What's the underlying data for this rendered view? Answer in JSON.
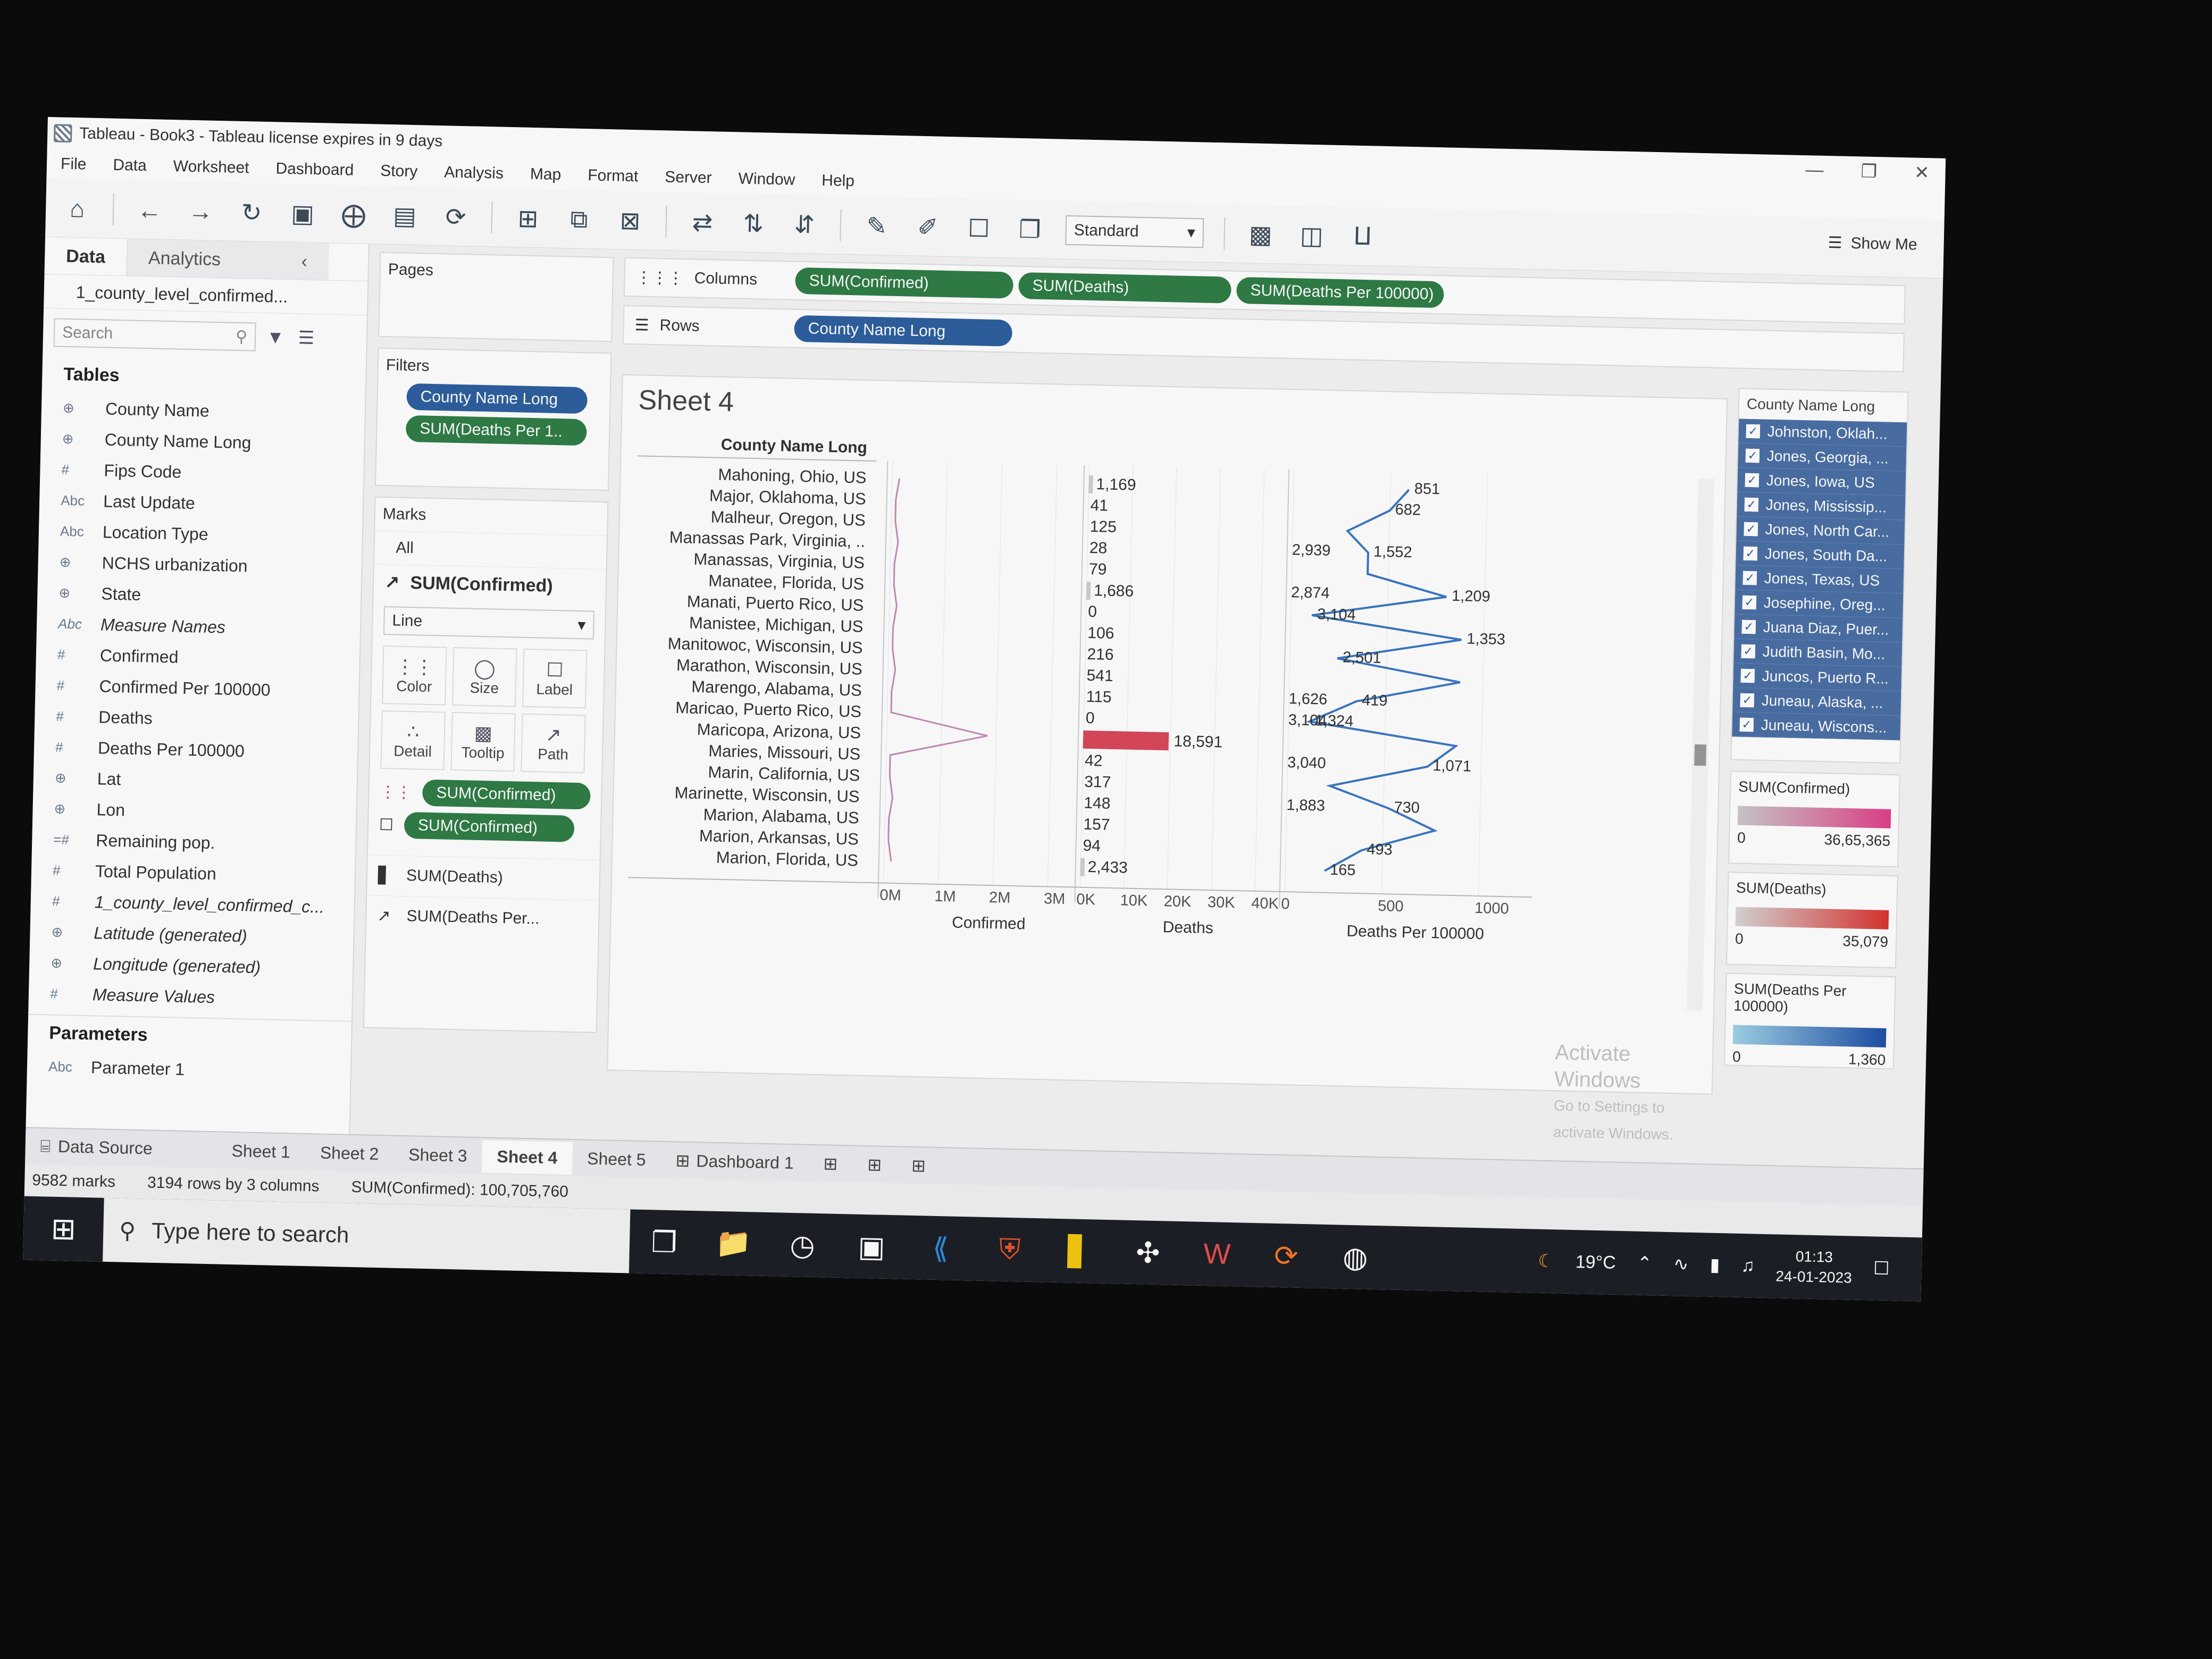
{
  "window": {
    "title": "Tableau - Book3 - Tableau license expires in 9 days"
  },
  "menu": [
    "File",
    "Data",
    "Worksheet",
    "Dashboard",
    "Story",
    "Analysis",
    "Map",
    "Format",
    "Server",
    "Window",
    "Help"
  ],
  "toolbar": {
    "fit_select": "Standard",
    "show_me": "Show Me"
  },
  "datapane": {
    "tab_data": "Data",
    "tab_analytics": "Analytics",
    "datasource": "1_county_level_confirmed...",
    "search_placeholder": "Search",
    "tables_header": "Tables",
    "fields": [
      {
        "icon": "globe",
        "name": "County Name"
      },
      {
        "icon": "globe",
        "name": "County Name Long"
      },
      {
        "icon": "#",
        "name": "Fips Code"
      },
      {
        "icon": "Abc",
        "name": "Last Update"
      },
      {
        "icon": "Abc",
        "name": "Location Type"
      },
      {
        "icon": "globe",
        "name": "NCHS urbanization"
      },
      {
        "icon": "globe",
        "name": "State"
      },
      {
        "icon": "Abc",
        "name": "Measure Names",
        "italic": true
      },
      {
        "icon": "#",
        "name": "Confirmed"
      },
      {
        "icon": "#",
        "name": "Confirmed Per 100000"
      },
      {
        "icon": "#",
        "name": "Deaths"
      },
      {
        "icon": "#",
        "name": "Deaths Per 100000"
      },
      {
        "icon": "globe",
        "name": "Lat"
      },
      {
        "icon": "globe",
        "name": "Lon"
      },
      {
        "icon": "=#",
        "name": "Remaining pop."
      },
      {
        "icon": "#",
        "name": "Total Population"
      },
      {
        "icon": "#",
        "name": "1_county_level_confirmed_c...",
        "italic": true
      },
      {
        "icon": "globe",
        "name": "Latitude (generated)",
        "italic": true
      },
      {
        "icon": "globe",
        "name": "Longitude (generated)",
        "italic": true
      },
      {
        "icon": "#",
        "name": "Measure Values",
        "italic": true
      }
    ],
    "parameters_header": "Parameters",
    "parameters": [
      {
        "icon": "Abc",
        "name": "Parameter 1"
      }
    ]
  },
  "pages": {
    "label": "Pages"
  },
  "filters": {
    "label": "Filters",
    "items": [
      "County Name Long",
      "SUM(Deaths Per 1.."
    ]
  },
  "marks": {
    "label": "Marks",
    "all": "All",
    "active": "SUM(Confirmed)",
    "type": "Line",
    "buttons": [
      "Color",
      "Size",
      "Label",
      "Detail",
      "Tooltip",
      "Path"
    ],
    "pills": [
      "SUM(Confirmed)",
      "SUM(Confirmed)"
    ],
    "other_cards": [
      "SUM(Deaths)",
      "SUM(Deaths Per..."
    ]
  },
  "shelves": {
    "columns_label": "Columns",
    "rows_label": "Rows",
    "columns": [
      "SUM(Confirmed)",
      "SUM(Deaths)",
      "SUM(Deaths Per 100000)"
    ],
    "rows": [
      "County Name Long"
    ]
  },
  "sheet": {
    "title": "Sheet 4",
    "row_header": "County Name Long"
  },
  "chart_data": {
    "type": "table",
    "rows": [
      "Mahoning, Ohio, US",
      "Major, Oklahoma, US",
      "Malheur, Oregon, US",
      "Manassas Park, Virginia, ..",
      "Manassas, Virginia, US",
      "Manatee, Florida, US",
      "Manati, Puerto Rico, US",
      "Manistee, Michigan, US",
      "Manitowoc, Wisconsin, US",
      "Marathon, Wisconsin, US",
      "Marengo, Alabama, US",
      "Maricao, Puerto Rico, US",
      "Maricopa, Arizona, US",
      "Maries, Missouri, US",
      "Marin, California, US",
      "Marinette, Wisconsin, US",
      "Marion, Alabama, US",
      "Marion, Arkansas, US",
      "Marion, Florida, US"
    ],
    "panes": [
      {
        "measure": "Confirmed",
        "type": "line",
        "axis_title": "Confirmed",
        "ticks": [
          "0M",
          "1M",
          "2M",
          "3M"
        ],
        "xlim": [
          0,
          3500000
        ],
        "peak_row": "Maricopa, Arizona, US"
      },
      {
        "measure": "Deaths",
        "type": "bar",
        "axis_title": "Deaths",
        "ticks": [
          "0K",
          "10K",
          "20K",
          "30K",
          "40K"
        ],
        "xlim": [
          0,
          45000
        ],
        "values": [
          1169,
          41,
          125,
          28,
          79,
          1686,
          0,
          106,
          216,
          541,
          115,
          0,
          18591,
          42,
          317,
          148,
          157,
          94,
          2433
        ],
        "labels": [
          "1,169",
          "41",
          "125",
          "28",
          "79",
          "1,686",
          "0",
          "106",
          "216",
          "541",
          "115",
          "0",
          "18,591",
          "42",
          "317",
          "148",
          "157",
          "94",
          "2,433"
        ]
      },
      {
        "measure": "Deaths Per 100000",
        "type": "line",
        "axis_title": "Deaths Per 100000",
        "ticks": [
          "0",
          "500",
          "1000"
        ],
        "xlim": [
          0,
          1200
        ],
        "values": [
          851,
          682,
          305,
          495,
          495,
          1209,
          0,
          1353,
          238,
          1350,
          419,
          0,
          1324,
          1071,
          195,
          730,
          1150,
          493,
          165
        ],
        "labels": [
          {
            "row": 0,
            "text": "851"
          },
          {
            "row": 1,
            "text": "682"
          },
          {
            "row": 3,
            "text": "2,939"
          },
          {
            "row": 3,
            "text": "1,552"
          },
          {
            "row": 5,
            "text": "2,874"
          },
          {
            "row": 5,
            "text": "1,209"
          },
          {
            "row": 6,
            "text": "3,104"
          },
          {
            "row": 7,
            "text": "1,353"
          },
          {
            "row": 8,
            "text": "2,501"
          },
          {
            "row": 10,
            "text": "1,626"
          },
          {
            "row": 10,
            "text": "419"
          },
          {
            "row": 11,
            "text": "3,104"
          },
          {
            "row": 11,
            "text": "1,324"
          },
          {
            "row": 13,
            "text": "3,040"
          },
          {
            "row": 13,
            "text": "1,071"
          },
          {
            "row": 15,
            "text": "1,883"
          },
          {
            "row": 15,
            "text": "730"
          },
          {
            "row": 17,
            "text": "493"
          },
          {
            "row": 18,
            "text": "165"
          }
        ]
      }
    ]
  },
  "legend_list": {
    "title": "County Name Long",
    "items": [
      "Johnston, Oklah...",
      "Jones, Georgia, ...",
      "Jones, Iowa, US",
      "Jones, Mississip...",
      "Jones, North Car...",
      "Jones, South Da...",
      "Jones, Texas, US",
      "Josephine, Oreg...",
      "Juana Diaz, Puer...",
      "Judith Basin, Mo...",
      "Juncos, Puerto R...",
      "Juneau, Alaska, ...",
      "Juneau, Wiscons..."
    ]
  },
  "color_legends": [
    {
      "title": "SUM(Confirmed)",
      "min": "0",
      "max": "36,65,365",
      "from": "#c9c9c9",
      "to": "#e0418a"
    },
    {
      "title": "SUM(Deaths)",
      "min": "0",
      "max": "35,079",
      "from": "#d6d6d6",
      "to": "#d9332f"
    },
    {
      "title": "SUM(Deaths Per 100000)",
      "min": "0",
      "max": "1,360",
      "from": "#9fd2e8",
      "to": "#1f4fa6"
    }
  ],
  "watermark": {
    "line1": "Activate Windows",
    "line2": "Go to Settings to activate Windows."
  },
  "tabs": {
    "datasource": "Data Source",
    "sheets": [
      "Sheet 1",
      "Sheet 2",
      "Sheet 3",
      "Sheet 4",
      "Sheet 5"
    ],
    "dashboard": "Dashboard 1",
    "active": "Sheet 4"
  },
  "status": {
    "marks": "9582 marks",
    "rows": "3194 rows by 3 columns",
    "sum": "SUM(Confirmed): 100,705,760"
  },
  "taskbar": {
    "search_placeholder": "Type here to search",
    "temperature": "19°C",
    "time": "01:13",
    "date": "24-01-2023"
  },
  "colors": {
    "pill_blue": "#2d5f9e",
    "pill_green": "#2f7d46",
    "bar_highlight": "#d9485a",
    "line_blue": "#3b78c4"
  }
}
